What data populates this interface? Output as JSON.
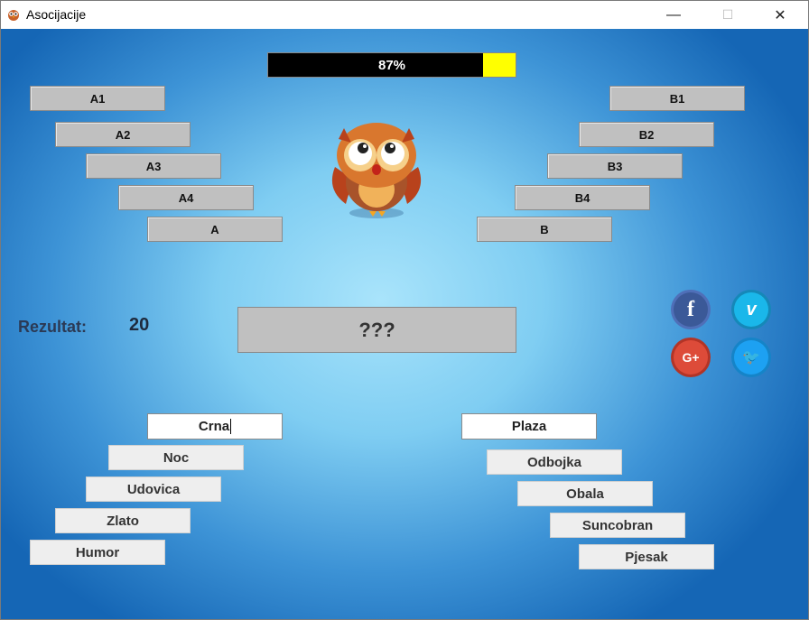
{
  "window": {
    "title": "Asocijacije",
    "controls": {
      "minimize": "—",
      "maximize": "☐",
      "close": "✕"
    }
  },
  "progress": {
    "label": "87%",
    "fraction": 0.87,
    "bar_color": "#000000",
    "remaining_color": "#ffff00"
  },
  "columns": {
    "a": {
      "cells": [
        "A1",
        "A2",
        "A3",
        "A4"
      ],
      "solution": "A"
    },
    "b": {
      "cells": [
        "B1",
        "B2",
        "B3",
        "B4"
      ],
      "solution": "B"
    }
  },
  "final_solution": "???",
  "score": {
    "label": "Rezultat:",
    "value": "20"
  },
  "social": {
    "facebook": {
      "icon": "facebook-icon",
      "glyph": "f",
      "color": "#3b5998"
    },
    "vimeo": {
      "icon": "vimeo-icon",
      "glyph": "v",
      "color": "#1ab7ea"
    },
    "google_plus": {
      "icon": "google-plus-icon",
      "glyph": "G+",
      "color": "#dd4b39"
    },
    "twitter": {
      "icon": "twitter-icon",
      "glyph": "🐦",
      "color": "#1da1f2"
    }
  },
  "left_words": {
    "input": "Crna",
    "items": [
      "Noc",
      "Udovica",
      "Zlato",
      "Humor"
    ]
  },
  "right_words": {
    "input": "Plaza",
    "items": [
      "Odbojka",
      "Obala",
      "Suncobran",
      "Pjesak"
    ]
  }
}
